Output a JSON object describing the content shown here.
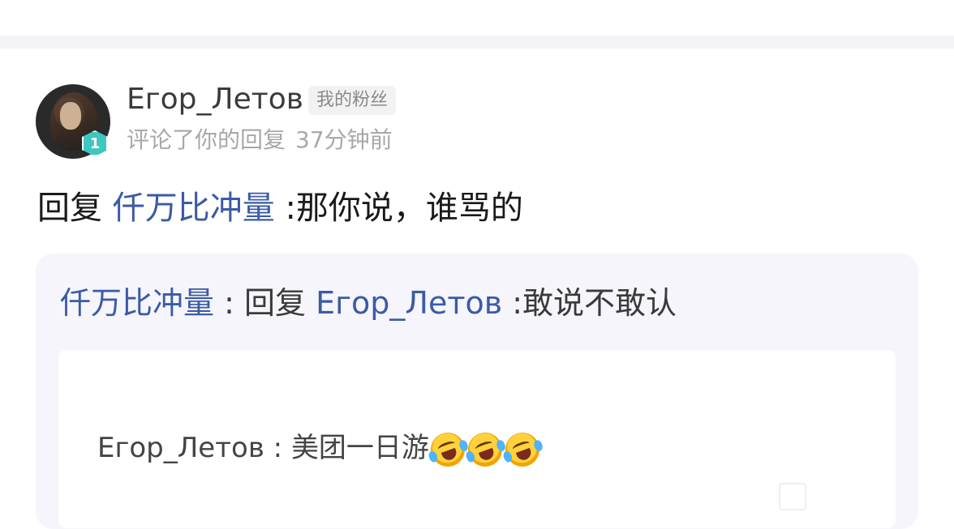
{
  "comment": {
    "username": "Егор_Летов",
    "fan_tag": "我的粉丝",
    "level": "1",
    "action": "评论了你的回复",
    "time": "37分钟前",
    "reply_prefix": "回复",
    "reply_target": "仟万比冲量",
    "reply_text": ":那你说，谁骂的"
  },
  "quote": {
    "author": "仟万比冲量",
    "separator": " : 回复 ",
    "target": "Егор_Летов",
    "text": ":敢说不敢认"
  },
  "original": {
    "author": "Егор_Летов",
    "separator": " : ",
    "text": "美团一日游",
    "emoji_icons": [
      "rolling-on-floor-laughing-icon",
      "rolling-on-floor-laughing-icon",
      "rolling-on-floor-laughing-icon"
    ]
  },
  "colors": {
    "link": "#3b5ba5",
    "badge": "#3ec7c0"
  }
}
